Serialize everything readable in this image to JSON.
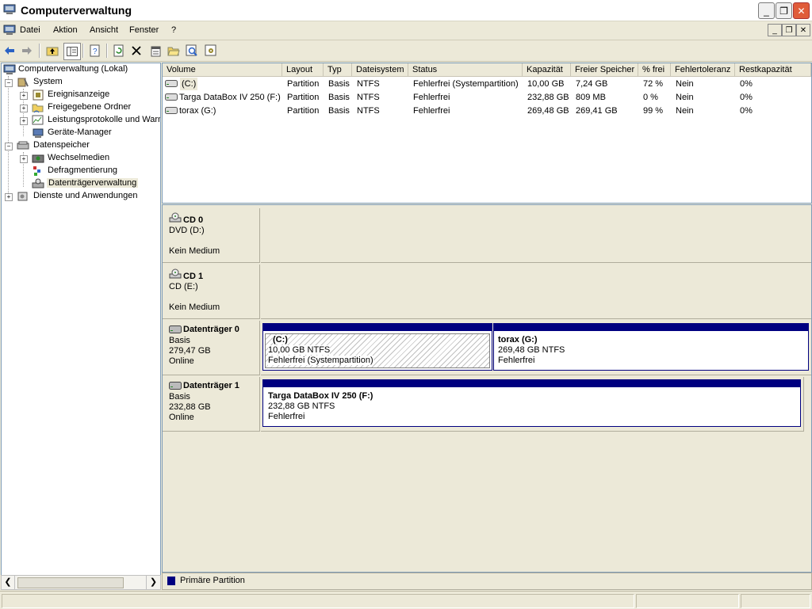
{
  "window": {
    "title": "Computerverwaltung"
  },
  "menu": [
    "Datei",
    "Aktion",
    "Ansicht",
    "Fenster",
    "?"
  ],
  "tree": {
    "root": "Computerverwaltung (Lokal)",
    "system": "System",
    "ereignis": "Ereignisanzeige",
    "freigabe": "Freigegebene Ordner",
    "leistung": "Leistungsprotokolle und Warn",
    "geraete": "Geräte-Manager",
    "datenspeicher": "Datenspeicher",
    "wechsel": "Wechselmedien",
    "defrag": "Defragmentierung",
    "dtv": "Datenträgerverwaltung",
    "dienste": "Dienste und Anwendungen"
  },
  "columns": [
    "Volume",
    "Layout",
    "Typ",
    "Dateisystem",
    "Status",
    "Kapazität",
    "Freier Speicher",
    "% frei",
    "Fehlertoleranz",
    "Restkapazität"
  ],
  "rows": [
    [
      "(C:)",
      "Partition",
      "Basis",
      "NTFS",
      "Fehlerfrei (Systempartition)",
      "10,00 GB",
      "7,24 GB",
      "72 %",
      "Nein",
      "0%"
    ],
    [
      "Targa DataBox IV 250 (F:)",
      "Partition",
      "Basis",
      "NTFS",
      "Fehlerfrei",
      "232,88 GB",
      "809 MB",
      "0 %",
      "Nein",
      "0%"
    ],
    [
      "torax (G:)",
      "Partition",
      "Basis",
      "NTFS",
      "Fehlerfrei",
      "269,48 GB",
      "269,41 GB",
      "99 %",
      "Nein",
      "0%"
    ]
  ],
  "disks": {
    "cd0": {
      "name": "CD 0",
      "line1": "DVD (D:)",
      "line3": "Kein Medium"
    },
    "cd1": {
      "name": "CD 1",
      "line1": "CD (E:)",
      "line3": "Kein Medium"
    },
    "d0": {
      "name": "Datenträger 0",
      "line1": "Basis",
      "line2": "279,47 GB",
      "line3": "Online",
      "v1": {
        "name": "(C:)",
        "size": "10,00 GB NTFS",
        "status": "Fehlerfrei (Systempartition)"
      },
      "v2": {
        "name": "torax  (G:)",
        "size": "269,48 GB NTFS",
        "status": "Fehlerfrei"
      }
    },
    "d1": {
      "name": "Datenträger 1",
      "line1": "Basis",
      "line2": "232,88 GB",
      "line3": "Online",
      "v1": {
        "name": "Targa DataBox IV 250  (F:)",
        "size": "232,88 GB NTFS",
        "status": "Fehlerfrei"
      }
    }
  },
  "legend": {
    "label": "Primäre Partition",
    "color": "#000080"
  },
  "icons": [
    "computer-icon",
    "back-icon",
    "forward-icon",
    "up-folder-icon",
    "show-hide-tree-icon",
    "help-icon",
    "refresh-icon",
    "delete-icon",
    "properties-icon",
    "open-icon",
    "search-icon",
    "settings-icon"
  ]
}
